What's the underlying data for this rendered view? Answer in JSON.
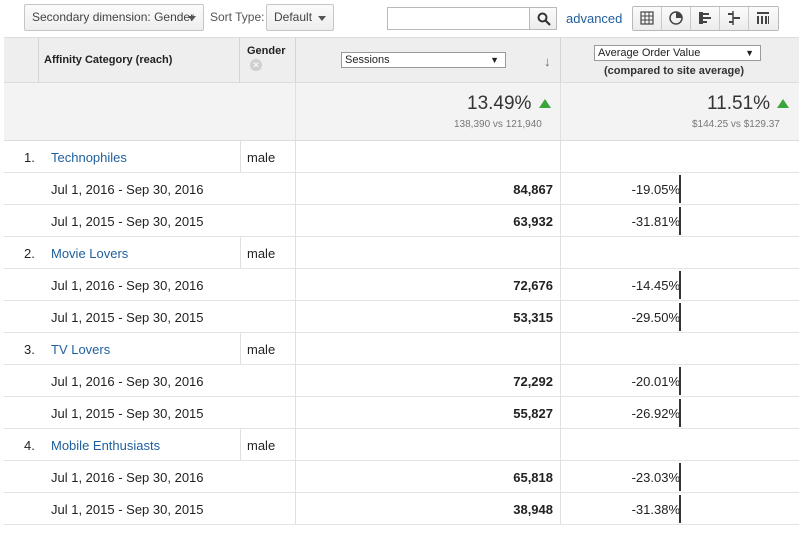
{
  "toolbar": {
    "secondary_dimension": "Secondary dimension: Gender",
    "sort_type_label": "Sort Type:",
    "sort_type_value": "Default",
    "search_value": "",
    "advanced": "advanced"
  },
  "table": {
    "header": {
      "category": "Affinity Category (reach)",
      "gender": "Gender",
      "metric1": "Sessions",
      "metric2": "Average Order Value",
      "metric2_sub": "(compared to site average)"
    },
    "totals": {
      "sessions_pct": "13.49%",
      "sessions_cmp": "138,390 vs 121,940",
      "aov_pct": "11.51%",
      "aov_cmp": "$144.25 vs $129.37"
    },
    "rows": [
      {
        "num": "1.",
        "category": "Technophiles",
        "gender": "male",
        "periods": [
          {
            "date": "Jul 1, 2016 - Sep 30, 2016",
            "sessions": "84,867",
            "aov": "-19.05%"
          },
          {
            "date": "Jul 1, 2015 - Sep 30, 2015",
            "sessions": "63,932",
            "aov": "-31.81%"
          }
        ]
      },
      {
        "num": "2.",
        "category": "Movie Lovers",
        "gender": "male",
        "periods": [
          {
            "date": "Jul 1, 2016 - Sep 30, 2016",
            "sessions": "72,676",
            "aov": "-14.45%"
          },
          {
            "date": "Jul 1, 2015 - Sep 30, 2015",
            "sessions": "53,315",
            "aov": "-29.50%"
          }
        ]
      },
      {
        "num": "3.",
        "category": "TV Lovers",
        "gender": "male",
        "periods": [
          {
            "date": "Jul 1, 2016 - Sep 30, 2016",
            "sessions": "72,292",
            "aov": "-20.01%"
          },
          {
            "date": "Jul 1, 2015 - Sep 30, 2015",
            "sessions": "55,827",
            "aov": "-26.92%"
          }
        ]
      },
      {
        "num": "4.",
        "category": "Mobile Enthusiasts",
        "gender": "male",
        "periods": [
          {
            "date": "Jul 1, 2016 - Sep 30, 2016",
            "sessions": "65,818",
            "aov": "-23.03%"
          },
          {
            "date": "Jul 1, 2015 - Sep 30, 2015",
            "sessions": "38,948",
            "aov": "-31.38%"
          }
        ]
      }
    ]
  },
  "colors": {
    "link": "#1f5f9e",
    "up_arrow": "#3aa53a",
    "header_bg": "#eeeeee"
  },
  "icons": [
    "chevron-down-icon",
    "search-icon",
    "grid-view-icon",
    "pie-view-icon",
    "bar-view-icon",
    "comparison-view-icon",
    "pivot-view-icon",
    "remove-dimension-icon",
    "sort-down-arrow-icon",
    "up-arrow-icon"
  ]
}
